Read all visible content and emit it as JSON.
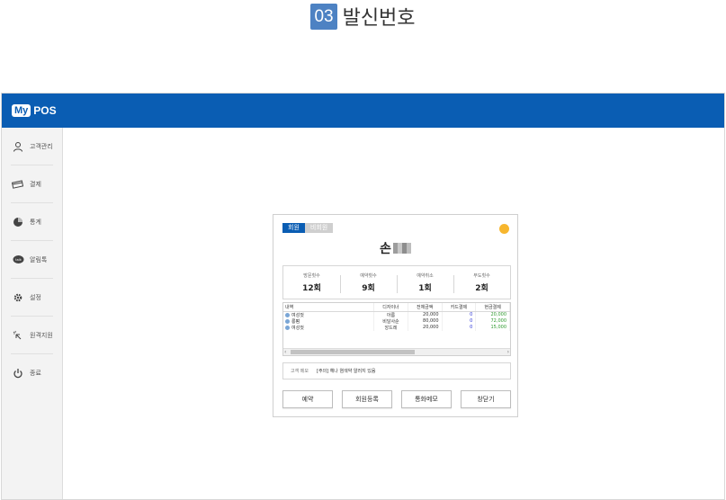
{
  "step": {
    "number": "03",
    "title": "발신번호"
  },
  "app": {
    "logo_my": "My",
    "logo_pos": "POS",
    "brand_color": "#0a5db3"
  },
  "sidebar": {
    "items": [
      {
        "label": "고객관리",
        "icon": "user-icon"
      },
      {
        "label": "결제",
        "icon": "card-icon"
      },
      {
        "label": "통계",
        "icon": "pie-chart-icon"
      },
      {
        "label": "알림톡",
        "icon": "talk-icon"
      },
      {
        "label": "설정",
        "icon": "gear-icon"
      },
      {
        "label": "원격지원",
        "icon": "remote-support-icon"
      },
      {
        "label": "종료",
        "icon": "power-icon"
      }
    ]
  },
  "dialog": {
    "tabs": [
      {
        "label": "회원"
      },
      {
        "label": "비회원"
      }
    ],
    "customer_name": "손",
    "status_color": "#f7b62e",
    "stats": [
      {
        "label": "방문횟수",
        "value": "12회"
      },
      {
        "label": "예약횟수",
        "value": "9회"
      },
      {
        "label": "예약취소",
        "value": "1회"
      },
      {
        "label": "부도횟수",
        "value": "2회"
      }
    ],
    "table": {
      "headers": [
        "내역",
        "디자이너",
        "전체금액",
        "카드결제",
        "현금결제"
      ],
      "rows": [
        {
          "item": "여성컷",
          "designer": "아름",
          "total": "20,000",
          "card": "0",
          "cash": "20,000"
        },
        {
          "item": "롱펌",
          "designer": "비달사순",
          "total": "80,000",
          "card": "0",
          "cash": "72,000"
        },
        {
          "item": "여성컷",
          "designer": "앙드레",
          "total": "20,000",
          "card": "0",
          "cash": "15,000"
        }
      ]
    },
    "memo": {
      "label": "고객 메모",
      "text": "[주의] 헤나 염색약 알러지 있음"
    },
    "buttons": {
      "reserve": "예약",
      "register": "회원등록",
      "call_memo": "통화메모",
      "close": "창닫기"
    }
  }
}
